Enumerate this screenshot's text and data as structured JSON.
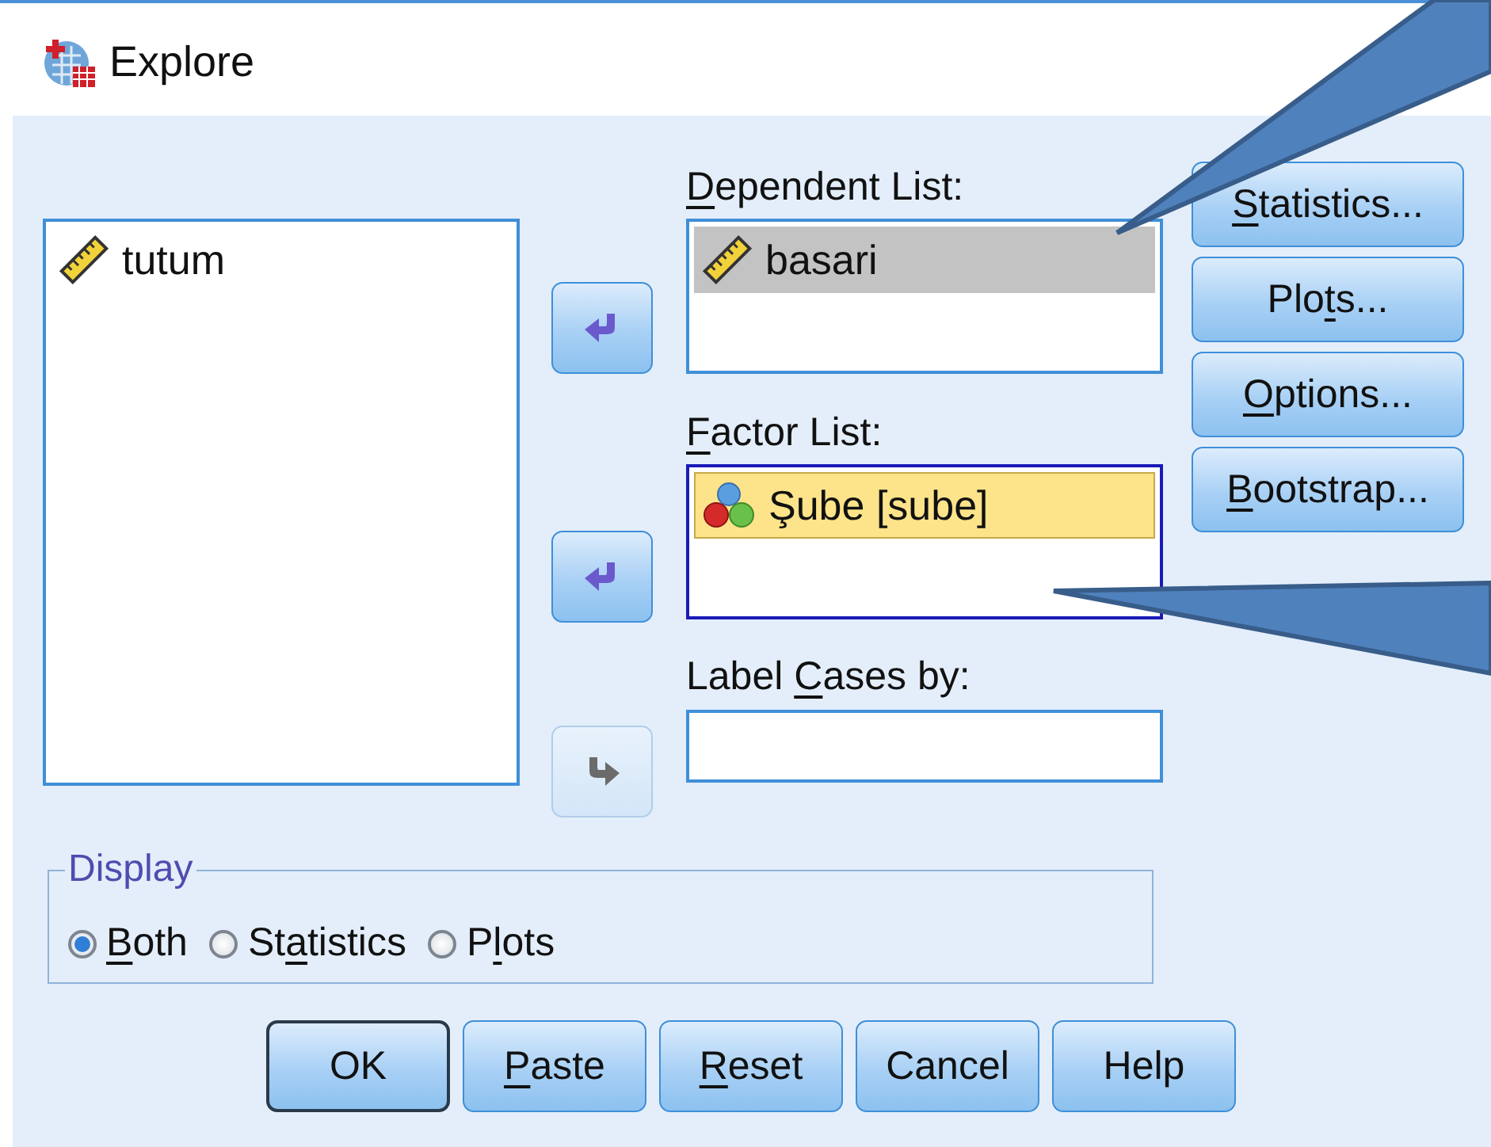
{
  "window": {
    "title": "Explore"
  },
  "source_list": {
    "focused": false,
    "items": [
      {
        "name": "tutum",
        "kind": "scale",
        "selected": false
      }
    ]
  },
  "arrow_buttons": [
    {
      "kind": "left",
      "disabled": false
    },
    {
      "kind": "left",
      "disabled": false
    },
    {
      "kind": "right",
      "disabled": true
    }
  ],
  "dependent_list": {
    "label": {
      "key": "D",
      "tail": "ependent List:"
    },
    "focused": false,
    "items": [
      {
        "name": "basari",
        "kind": "scale",
        "selected": true
      }
    ]
  },
  "factor_list": {
    "label": {
      "key": "F",
      "tail": "actor List:"
    },
    "focused": true,
    "items": [
      {
        "name": "Şube [sube]",
        "kind": "nominal",
        "selected": true
      }
    ]
  },
  "label_cases": {
    "label": {
      "head": "Label ",
      "key": "C",
      "tail": "ases by:"
    }
  },
  "side_buttons": [
    {
      "label": {
        "key": "S",
        "tail": "tatistics..."
      }
    },
    {
      "label": {
        "head": "Plo",
        "key": "t",
        "tail": "s..."
      }
    },
    {
      "label": {
        "key": "O",
        "tail": "ptions..."
      }
    },
    {
      "label": {
        "key": "B",
        "tail": "ootstrap..."
      }
    }
  ],
  "display": {
    "legend": "Display",
    "options": [
      {
        "label": {
          "key": "B",
          "tail": "oth"
        },
        "selected": true
      },
      {
        "label": {
          "head": "St",
          "key": "a",
          "tail": "tistics"
        },
        "selected": false
      },
      {
        "label": {
          "head": "P",
          "key": "l",
          "tail": "ots"
        },
        "selected": false
      }
    ]
  },
  "buttons": [
    {
      "label": {
        "head": "OK"
      },
      "default": true
    },
    {
      "label": {
        "key": "P",
        "tail": "aste"
      },
      "default": false
    },
    {
      "label": {
        "key": "R",
        "tail": "eset"
      },
      "default": false
    },
    {
      "label": {
        "head": "Cancel"
      },
      "default": false
    },
    {
      "label": {
        "head": "Help"
      },
      "default": false
    }
  ]
}
